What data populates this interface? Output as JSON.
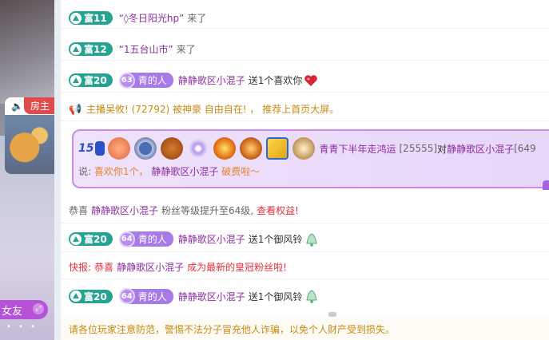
{
  "video": {
    "host_label": "房主",
    "friend_label": "女友",
    "dots": "• • •"
  },
  "messages": [
    {
      "badge": "富11",
      "user": "“◊冬日阳光hp”",
      "text": "来了"
    },
    {
      "badge": "富12",
      "user": "“1五台山市”",
      "text": "来了"
    },
    {
      "badge": "富20",
      "level": "63",
      "title": "青的人",
      "user": "静静歌区小混子",
      "text": "送1个喜欢你"
    }
  ],
  "announcement": {
    "text": "主播吴攸!  (72792)  被神豪 自由自在! ， 推荐上首页大屏。"
  },
  "gift_card": {
    "seq": "15",
    "sender": "青青下半年走鸿运",
    "sender_id": "[25555]",
    "to_label": "对",
    "receiver": "静静歌区小混子",
    "receiver_id_partial": "[649",
    "say_label": "说:",
    "say_text": "喜欢你1个，",
    "say_user": "静静歌区小混子",
    "say_tail": "破费啦～",
    "icon_names": [
      "crown-medal-icon",
      "star-medal-icon",
      "compass-medal-icon",
      "bronze-shield-icon",
      "sparkle-medal-icon",
      "fire-orb-icon",
      "bull-crown-icon",
      "gold-car-icon",
      "level-medal-icon"
    ]
  },
  "fan_upgrade": {
    "prefix": "恭喜",
    "user": "静静歌区小混子",
    "text": "粉丝等级提升至64级,",
    "link": "查看权益!"
  },
  "gift2": {
    "badge": "富20",
    "level": "64",
    "title": "青的人",
    "user": "静静歌区小混子",
    "text": "送1个御风铃"
  },
  "news": {
    "prefix": "快报:",
    "congrats": "恭喜",
    "user": "静静歌区小混子",
    "text": "成为最新的皇冠粉丝啦!"
  },
  "gift3": {
    "badge": "富20",
    "level": "64",
    "title": "青的人",
    "user": "静静歌区小混子",
    "text": "送1个御风铃"
  },
  "warning": {
    "text": "请各位玩家注意防范，警惕不法分子冒充他人诈骗，以免个人财产受到损失。"
  },
  "colors": {
    "badge_green": "#27a391",
    "level_purple": "#a87ae8",
    "username_purple": "#8a2d9e",
    "warning_gold": "#c68a15",
    "alert_red": "#e0303e"
  }
}
